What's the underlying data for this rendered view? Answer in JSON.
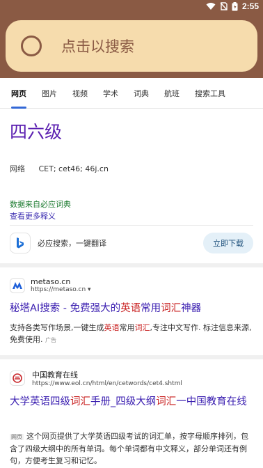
{
  "status": {
    "time": "2:55"
  },
  "search": {
    "placeholder": "点击以搜索"
  },
  "tabs": [
    "网页",
    "图片",
    "视频",
    "学术",
    "词典",
    "航班",
    "搜索工具"
  ],
  "dict": {
    "word": "四六级",
    "row_label": "网络",
    "row_value": "CET; cet46; 46j.cn",
    "source": "数据来自必应词典",
    "more": "查看更多释义",
    "bing_text": "必应搜索，一键翻译",
    "download": "立即下载"
  },
  "results": [
    {
      "site": "metaso.cn",
      "url": "https://metaso.cn",
      "title_parts": [
        "秘塔AI搜索 - 免费强大的",
        "英语",
        "常用",
        "词汇",
        "神器"
      ],
      "desc_parts": [
        "支持各类写作场景,一键生成",
        "英语",
        "常用",
        "词汇",
        ",专注中文写作. 标注信息来源,免费使用."
      ],
      "ad": "广告"
    },
    {
      "site": "中国教育在线",
      "url": "https://www.eol.cn/html/en/cetwords/cet4.shtml",
      "title_parts": [
        "大学英语四级",
        "词汇",
        "手册_四级大纲",
        "词汇",
        "一中国教育在线"
      ],
      "tag": "网页",
      "desc": "这个网页提供了大学英语四级考试的词汇单，按字母顺序排列，包含了四级大纲中的所有单词。每个单词都有中文释义，部分单词还有例句，方便考生复习和记忆。"
    }
  ]
}
